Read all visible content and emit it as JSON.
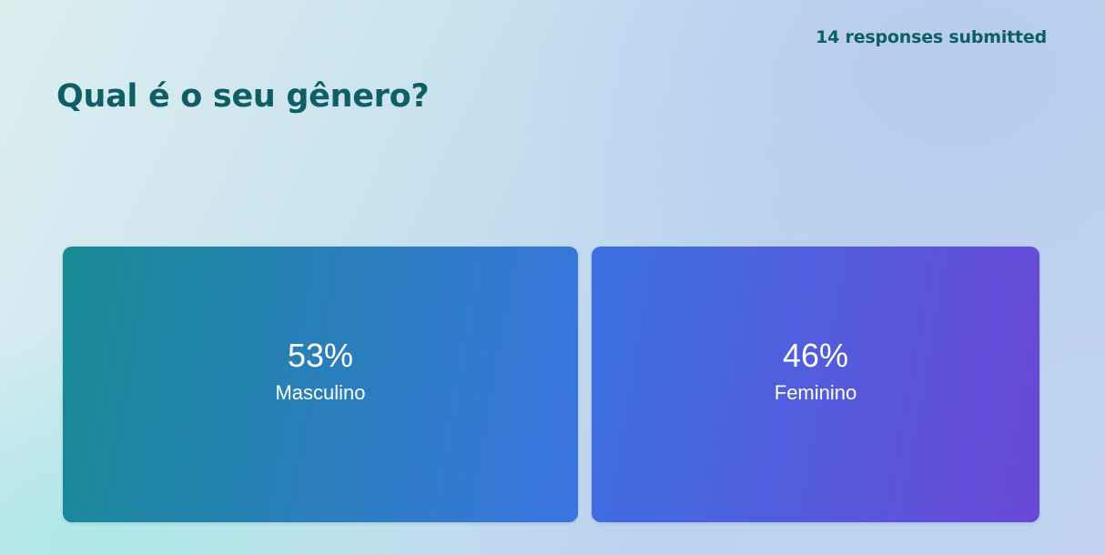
{
  "header": {
    "responses_text": "14 responses submitted"
  },
  "question": {
    "title": "Qual é o seu gênero?"
  },
  "colors": {
    "title": "#0e5e66",
    "tile_gradients": [
      [
        "#178a93",
        "#3a74e0"
      ],
      [
        "#3a70e2",
        "#6a48d8"
      ]
    ]
  },
  "chart_data": {
    "type": "bar",
    "categories": [
      "Masculino",
      "Feminino"
    ],
    "values": [
      53,
      46
    ],
    "value_labels": [
      "53%",
      "46%"
    ],
    "unit": "%"
  }
}
